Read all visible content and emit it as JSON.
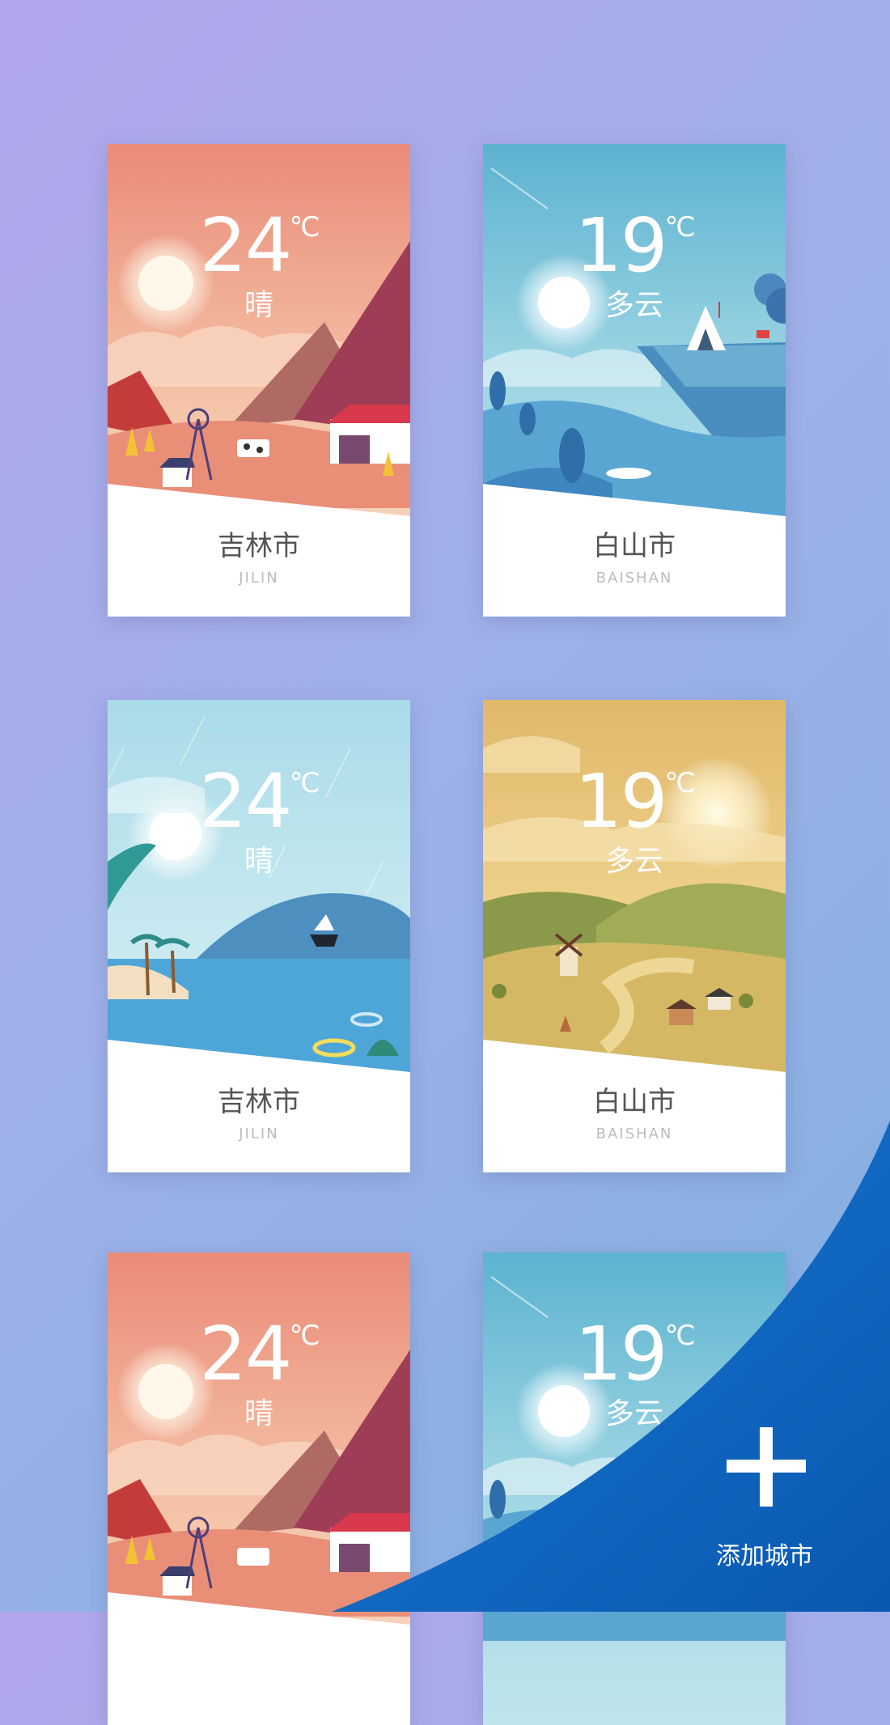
{
  "cards": [
    {
      "temp": "24",
      "unit": "℃",
      "condition": "晴",
      "city": "吉林市",
      "city_en": "JILIN",
      "scene": "sunset-mountains"
    },
    {
      "temp": "19",
      "unit": "℃",
      "condition": "多云",
      "city": "白山市",
      "city_en": "BAISHAN",
      "scene": "blue-cliff"
    },
    {
      "temp": "24",
      "unit": "℃",
      "condition": "晴",
      "city": "吉林市",
      "city_en": "JILIN",
      "scene": "tropical-sea"
    },
    {
      "temp": "19",
      "unit": "℃",
      "condition": "多云",
      "city": "白山市",
      "city_en": "BAISHAN",
      "scene": "golden-farm"
    },
    {
      "temp": "24",
      "unit": "℃",
      "condition": "晴",
      "city": "",
      "city_en": "",
      "scene": "sunset-mountains"
    },
    {
      "temp": "19",
      "unit": "℃",
      "condition": "多云",
      "city": "",
      "city_en": "",
      "scene": "blue-cliff"
    }
  ],
  "add_city": {
    "label": "添加城市",
    "icon": "plus-icon"
  },
  "colors": {
    "accent": "#0f6fcb",
    "accent_dark": "#0a4fa8"
  }
}
